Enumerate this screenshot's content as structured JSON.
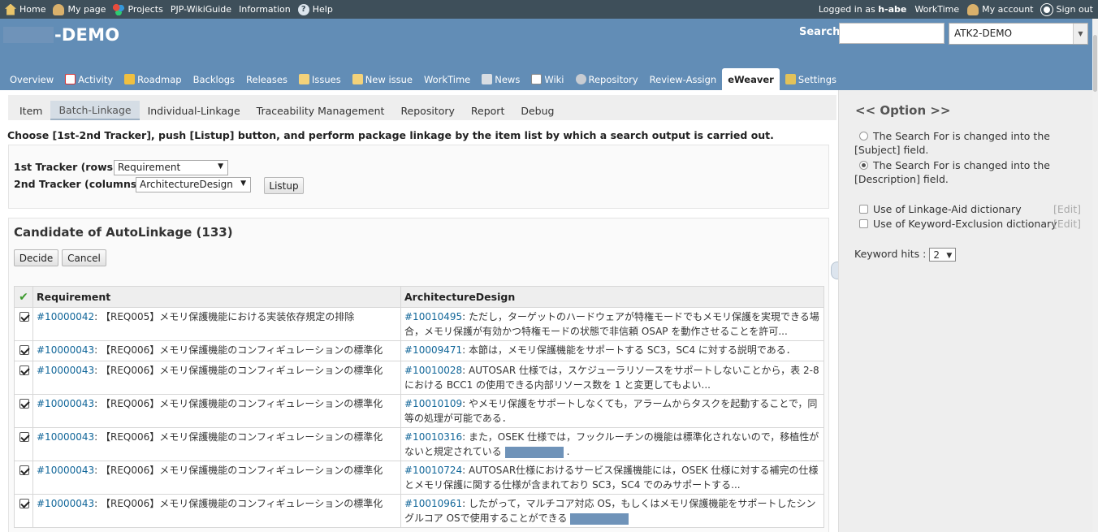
{
  "top_menu": {
    "left": [
      {
        "label": "Home",
        "icon": "home-icon"
      },
      {
        "label": "My page",
        "icon": "person-icon"
      },
      {
        "label": "Projects",
        "icon": "projects-icon"
      },
      {
        "label": "PJP-WikiGuide",
        "icon": ""
      },
      {
        "label": "Information",
        "icon": ""
      },
      {
        "label": "Help",
        "icon": "help-icon"
      }
    ],
    "logged_in_prefix": "Logged in as",
    "user": "h-abe",
    "right": [
      {
        "label": "WorkTime",
        "icon": ""
      },
      {
        "label": "My account",
        "icon": "person-icon"
      },
      {
        "label": "Sign out",
        "icon": "signout-icon"
      }
    ]
  },
  "header": {
    "title": "-DEMO",
    "search_label": "Search:",
    "search_value": "",
    "project_select": "ATK2-DEMO"
  },
  "main_menu": [
    {
      "label": "Overview",
      "icon": ""
    },
    {
      "label": "Activity",
      "icon": "activity-icon"
    },
    {
      "label": "Roadmap",
      "icon": "roadmap-icon"
    },
    {
      "label": "Backlogs",
      "icon": ""
    },
    {
      "label": "Releases",
      "icon": ""
    },
    {
      "label": "Issues",
      "icon": "issues-icon"
    },
    {
      "label": "New issue",
      "icon": "new-issue-icon"
    },
    {
      "label": "WorkTime",
      "icon": ""
    },
    {
      "label": "News",
      "icon": "news-icon"
    },
    {
      "label": "Wiki",
      "icon": "wiki-icon"
    },
    {
      "label": "Repository",
      "icon": "repository-icon"
    },
    {
      "label": "Review-Assign",
      "icon": ""
    },
    {
      "label": "eWeaver",
      "icon": "",
      "selected": true
    },
    {
      "label": "Settings",
      "icon": "settings-icon"
    }
  ],
  "sub_tabs": [
    {
      "label": "Item"
    },
    {
      "label": "Batch-Linkage",
      "selected": true
    },
    {
      "label": "Individual-Linkage"
    },
    {
      "label": "Traceability Management"
    },
    {
      "label": "Repository"
    },
    {
      "label": "Report"
    },
    {
      "label": "Debug"
    }
  ],
  "instruction": "Choose [1st-2nd Tracker], push [Listup] button, and perform package linkage by the item list by which a search output is carried out.",
  "tracker_form": {
    "first_label": "1st Tracker (rows)",
    "first_value": "Requirement",
    "second_label": "2nd Tracker (columns)",
    "second_value": "ArchitectureDesign",
    "listup_label": "Listup"
  },
  "candidates": {
    "title": "Candidate of AutoLinkage (133)",
    "decide_label": "Decide",
    "cancel_label": "Cancel",
    "columns": [
      "Requirement",
      "ArchitectureDesign"
    ],
    "rows": [
      {
        "checked": true,
        "req_id": "#10000042",
        "req_text": ": 【REQ005】メモリ保護機能における実装依存規定の排除",
        "arch_id": "#10010495",
        "arch_text": ": ただし，ターゲットのハードウェアが特権モードでもメモリ保護を実現できる場合，メモリ保護が有効かつ特権モードの状態で非信頼 OSAP を動作させることを許可...",
        "redact": false,
        "arch_tail": ""
      },
      {
        "checked": true,
        "req_id": "#10000043",
        "req_text": ": 【REQ006】メモリ保護機能のコンフィギュレーションの標準化",
        "arch_id": "#10009471",
        "arch_text": ": 本節は，メモリ保護機能をサポートする SC3，SC4 に対する説明である．",
        "redact": false,
        "arch_tail": ""
      },
      {
        "checked": true,
        "req_id": "#10000043",
        "req_text": ": 【REQ006】メモリ保護機能のコンフィギュレーションの標準化",
        "arch_id": "#10010028",
        "arch_text": ": AUTOSAR 仕様では，スケジューラリソースをサポートしないことから，表 2-8 における BCC1 の使用できる内部リソース数を 1 と変更してもよい...",
        "redact": false,
        "arch_tail": ""
      },
      {
        "checked": true,
        "req_id": "#10000043",
        "req_text": ": 【REQ006】メモリ保護機能のコンフィギュレーションの標準化",
        "arch_id": "#10010109",
        "arch_text": ": やメモリ保護をサポートしなくても，アラームからタスクを起動することで，同等の処理が可能である．",
        "redact": false,
        "arch_tail": ""
      },
      {
        "checked": true,
        "req_id": "#10000043",
        "req_text": ": 【REQ006】メモリ保護機能のコンフィギュレーションの標準化",
        "arch_id": "#10010316",
        "arch_text": ": また，OSEK 仕様では，フックルーチンの機能は標準化されないので，移植性がないと規定されている",
        "redact": true,
        "arch_tail": "."
      },
      {
        "checked": true,
        "req_id": "#10000043",
        "req_text": ": 【REQ006】メモリ保護機能のコンフィギュレーションの標準化",
        "arch_id": "#10010724",
        "arch_text": ": AUTOSAR仕様におけるサービス保護機能には，OSEK 仕様に対する補完の仕様とメモリ保護に関する仕様が含まれており SC3，SC4 でのみサポートする...",
        "redact": false,
        "arch_tail": ""
      },
      {
        "checked": true,
        "req_id": "#10000043",
        "req_text": ": 【REQ006】メモリ保護機能のコンフィギュレーションの標準化",
        "arch_id": "#10010961",
        "arch_text": ": したがって，マルチコア対応 OS，もしくはメモリ保護機能をサポートしたシングルコア OSで使用することができる",
        "redact": true,
        "arch_tail": ""
      }
    ]
  },
  "sidebar": {
    "title": "<< Option >>",
    "option_subject": "The Search For is changed into the [Subject] field.",
    "option_description": "The Search For is changed into the [Description] field.",
    "selected_option": "description",
    "linkage_aid_label": "Use of Linkage-Aid dictionary",
    "keyword_exclusion_label": "Use of Keyword-Exclusion dictionary",
    "edit_label": "[Edit]",
    "keyword_hits_label": "Keyword hits :",
    "keyword_hits_value": "2"
  }
}
